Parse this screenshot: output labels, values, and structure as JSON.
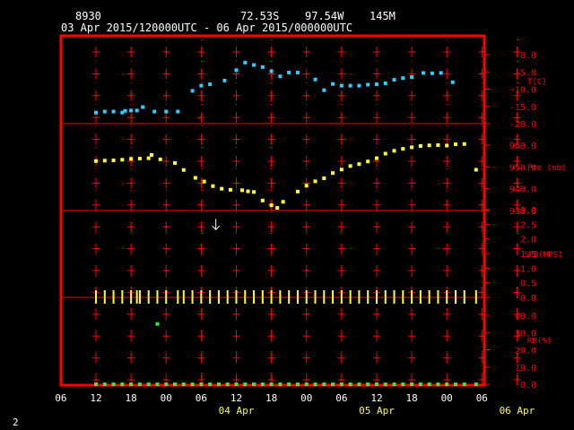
{
  "header": {
    "station": "8930",
    "lat": "72.53S",
    "lon": "97.54W",
    "elev": "145M",
    "period": "03 Apr 2015/120000UTC - 06 Apr 2015/000000UTC"
  },
  "footer": {
    "page_number": "2"
  },
  "colors": {
    "frame": "#ff0000",
    "axis_text": "#ff0000",
    "temp": "#33ccff",
    "pres": "#ffff33",
    "wind": "#ffff33",
    "rh": "#33ee33",
    "time_text": "#ffff33",
    "header_text": "#ffffff"
  },
  "chart_data": {
    "type": "scatter",
    "x_tick_labels": [
      "06",
      "12",
      "18",
      "00",
      "06",
      "12",
      "18",
      "00",
      "06",
      "12",
      "18",
      "00",
      "06"
    ],
    "x_day_labels": [
      "04 Apr",
      "05 Apr",
      "06 Apr"
    ],
    "x_day_label_hours": [
      24,
      48,
      72
    ],
    "x_hour_range": [
      -6,
      78
    ],
    "panels": [
      {
        "name": "temperature",
        "label": "T(C)",
        "ylim": [
          -20,
          2
        ],
        "tick_values": [
          0,
          -5,
          -10,
          -15,
          -20
        ],
        "tick_labels": [
          "0.0",
          "-5.0",
          "-10.0",
          "-15.0",
          "-20.0"
        ],
        "points": [
          [
            0,
            -16.8
          ],
          [
            1.5,
            -16.5
          ],
          [
            3,
            -16.5
          ],
          [
            4.5,
            -16.8
          ],
          [
            5,
            -16.3
          ],
          [
            6,
            -16.2
          ],
          [
            7,
            -16.2
          ],
          [
            8,
            -15.2
          ],
          [
            10,
            -16.5
          ],
          [
            12,
            -16.5
          ],
          [
            14,
            -16.5
          ],
          [
            16.5,
            -10.5
          ],
          [
            18,
            -9
          ],
          [
            19.5,
            -8.6
          ],
          [
            22,
            -7.5
          ],
          [
            24,
            -4.5
          ],
          [
            25.5,
            -2.3
          ],
          [
            27,
            -3
          ],
          [
            28.5,
            -3.6
          ],
          [
            30,
            -4.8
          ],
          [
            31.5,
            -6.3
          ],
          [
            33,
            -5.2
          ],
          [
            34.5,
            -5.2
          ],
          [
            37.5,
            -7.2
          ],
          [
            39,
            -10.3
          ],
          [
            40.5,
            -8.5
          ],
          [
            42,
            -9
          ],
          [
            43.5,
            -9
          ],
          [
            45,
            -9
          ],
          [
            46.5,
            -8.7
          ],
          [
            48,
            -8.6
          ],
          [
            49.5,
            -8.3
          ],
          [
            51,
            -7.3
          ],
          [
            52.5,
            -6.8
          ],
          [
            54,
            -6.5
          ],
          [
            56,
            -5.3
          ],
          [
            57.5,
            -5.4
          ],
          [
            59,
            -5.3
          ],
          [
            61,
            -8
          ]
        ]
      },
      {
        "name": "pressure",
        "label": "Pre (mb)",
        "ylim": [
          930,
          970
        ],
        "tick_values": [
          960,
          950,
          940,
          930
        ],
        "tick_labels": [
          "960.0",
          "950.0",
          "940.0",
          "930.0"
        ],
        "points": [
          [
            0,
            952.7
          ],
          [
            1.5,
            952.9
          ],
          [
            3,
            953
          ],
          [
            4.5,
            953.3
          ],
          [
            6,
            953.7
          ],
          [
            7.5,
            953.8
          ],
          [
            9,
            954
          ],
          [
            9.5,
            955.5
          ],
          [
            11,
            953.5
          ],
          [
            13.5,
            951.8
          ],
          [
            15,
            948.6
          ],
          [
            17,
            945
          ],
          [
            18.5,
            943.3
          ],
          [
            20,
            941.2
          ],
          [
            21.5,
            940
          ],
          [
            23,
            939.5
          ],
          [
            25,
            939.3
          ],
          [
            26,
            938.8
          ],
          [
            27,
            938.5
          ],
          [
            28.5,
            934.6
          ],
          [
            30,
            932.4
          ],
          [
            31,
            931.2
          ],
          [
            32,
            934
          ],
          [
            34.5,
            938.7
          ],
          [
            36,
            941.4
          ],
          [
            37.5,
            943.4
          ],
          [
            39,
            944.8
          ],
          [
            40.5,
            947.2
          ],
          [
            42,
            948.8
          ],
          [
            43.5,
            950.4
          ],
          [
            45,
            951.3
          ],
          [
            46.5,
            952.5
          ],
          [
            48,
            954
          ],
          [
            49.5,
            956.1
          ],
          [
            51,
            957.4
          ],
          [
            52.5,
            958.3
          ],
          [
            54,
            959
          ],
          [
            55.5,
            959.6
          ],
          [
            57,
            959.9
          ],
          [
            58.5,
            960
          ],
          [
            60,
            959.8
          ],
          [
            61.5,
            960.4
          ],
          [
            63,
            960.5
          ],
          [
            65,
            948.7
          ]
        ]
      },
      {
        "name": "wind",
        "label": "SPD(MPS)",
        "ylim": [
          -0.2,
          3.5
        ],
        "tick_values": [
          3.0,
          2.5,
          2.0,
          1.5,
          1.0,
          0.5,
          0.0
        ],
        "tick_labels": [
          "3.0",
          "2.5",
          "2.0",
          "1.5",
          "1.0",
          "0.5",
          "0.0"
        ],
        "speed_hours": [
          0,
          1.5,
          3,
          4.5,
          6,
          7,
          7.5,
          9,
          10.5,
          12,
          14,
          15,
          16.5,
          18,
          19.5,
          21,
          22.5,
          24,
          25.5,
          27,
          28.5,
          30,
          31.5,
          33,
          34.5,
          36,
          37.5,
          39,
          40.5,
          42,
          43.5,
          45,
          46.5,
          48,
          49.5,
          51,
          52.5,
          54,
          55.5,
          57,
          58.5,
          60,
          61.5,
          63,
          65
        ],
        "arrow": {
          "hour": 20.5,
          "speed": 2.5
        }
      },
      {
        "name": "rh",
        "label": "RH(%)",
        "ylim": [
          0,
          45
        ],
        "tick_values": [
          40,
          30,
          20,
          10,
          0
        ],
        "tick_labels": [
          "40.0",
          "30.0",
          "20.0",
          "10.0",
          "0.0"
        ],
        "points": [
          [
            10.5,
            35
          ]
        ],
        "bottom_points": [
          0,
          1.5,
          3,
          4.5,
          6,
          7.5,
          9,
          10.5,
          12,
          13.5,
          15,
          16.5,
          18,
          19.5,
          21,
          22.5,
          24,
          25.5,
          27,
          28.5,
          30,
          31.5,
          33,
          34.5,
          36,
          37.5,
          39,
          40.5,
          42,
          43.5,
          45,
          46.5,
          48,
          49.5,
          51,
          52.5,
          54,
          55.5,
          57,
          58.5,
          60,
          61.5,
          63,
          65
        ]
      }
    ]
  }
}
